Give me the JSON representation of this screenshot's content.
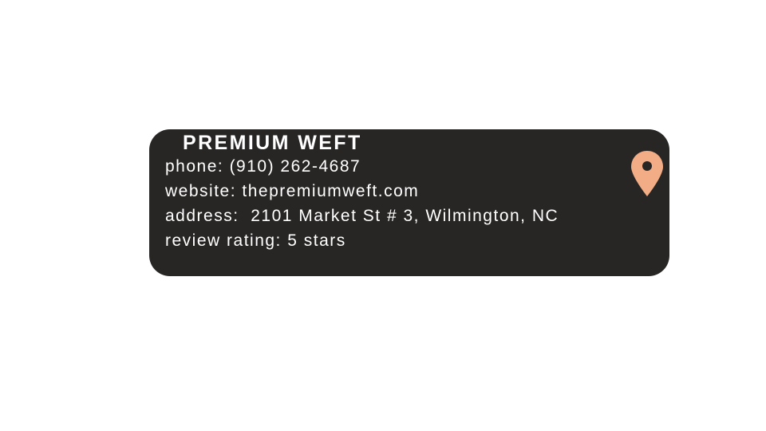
{
  "business": {
    "name": "PREMIUM WEFT",
    "phone": "phone: (910) 262-4687",
    "website": "website: thepremiumweft.com",
    "address": "address:  2101 Market St # 3, Wilmington, NC",
    "rating": "review rating: 5 stars"
  },
  "icons": {
    "pin": "map-pin-icon"
  },
  "colors": {
    "card_background": "#282625",
    "text": "#ffffff",
    "pin": "#f3ad86",
    "pin_dot": "#282625"
  }
}
